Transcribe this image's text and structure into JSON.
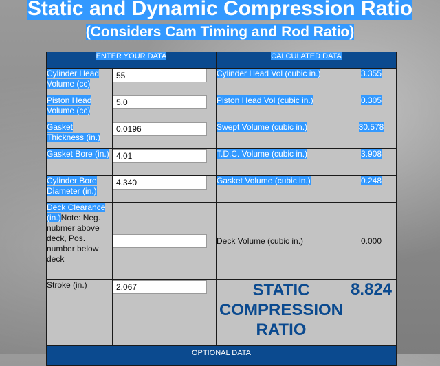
{
  "header": {
    "title": "Static and Dynamic Compression Ratio",
    "subtitle": "(Considers Cam Timing and Rod Ratio)"
  },
  "table": {
    "enter_header": "ENTER YOUR DATA",
    "calc_header": "CALCULATED DATA",
    "rows": [
      {
        "label": "Cylinder Head Volume (cc)",
        "value": "55",
        "calc_label": "Cylinder Head Vol (cubic in.)",
        "calc_value": "3.355"
      },
      {
        "label": "Piston Head Volume (cc)",
        "value": "5.0",
        "calc_label": "Piston Head Vol (cubic in.)",
        "calc_value": "0.305"
      },
      {
        "label": "Gasket Thickness (in.)",
        "value": "0.0196",
        "calc_label": "Swept Volume (cubic in.)",
        "calc_value": "30.578"
      },
      {
        "label": "Gasket Bore (in.)",
        "value": "4.01",
        "calc_label": "T.D.C. Volume (cubic in.)",
        "calc_value": "3.908"
      },
      {
        "label": "Cylinder Bore Diameter (in.)",
        "value": "4.340",
        "calc_label": "Gasket Volume (cubic in.)",
        "calc_value": "0.248"
      }
    ],
    "deck": {
      "label_selected": "Deck Clearance (in.)",
      "label_note": "Note: Neg. nubmer above deck, Pos. number below deck",
      "value": "",
      "calc_label": "Deck Volume (cubic in.)",
      "calc_value": "0.000"
    },
    "stroke": {
      "label": "Stroke (in.)",
      "value": "2.067",
      "static_label": "STATIC COMPRESSION RATIO",
      "static_value": "8.824"
    },
    "optional_header": "OPTIONAL DATA"
  },
  "colors": {
    "header_blue": "#0b4a8f",
    "selection_blue": "#3399ff",
    "cell_gray": "#c3c3c3"
  }
}
